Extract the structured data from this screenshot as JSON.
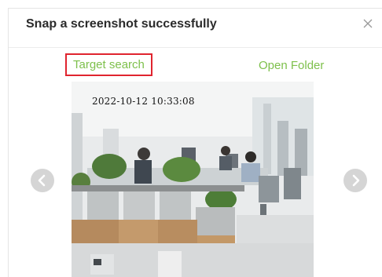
{
  "dialog": {
    "title": "Snap a screenshot successfully",
    "close_icon": "close-icon"
  },
  "actions": {
    "target_search_label": "Target search",
    "open_folder_label": "Open Folder",
    "accent_color": "#7ec04c",
    "highlight_color": "#e0242f"
  },
  "navigation": {
    "prev_icon": "chevron-left-icon",
    "next_icon": "chevron-right-icon"
  },
  "snapshot": {
    "timestamp": "2022-10-12 10:33:08"
  }
}
